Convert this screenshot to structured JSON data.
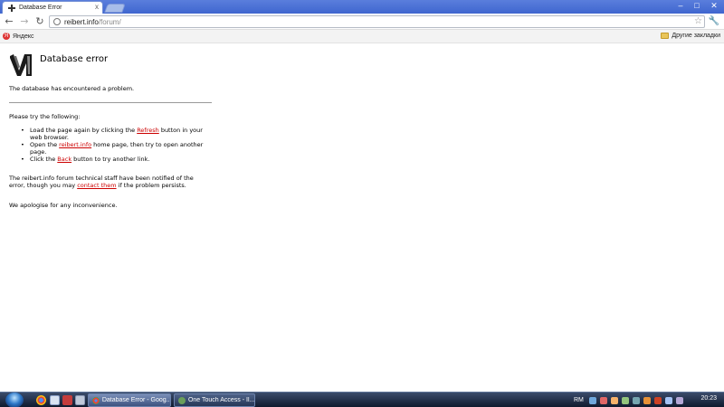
{
  "browser": {
    "tab_title": "Database Error",
    "tab_close": "x",
    "window_controls": {
      "minimize": "–",
      "maximize": "□",
      "close": "✕"
    },
    "url_host": "reibert.info",
    "url_path": "/forum/",
    "bookmark_yandex": "Яндекс",
    "bookmark_yandex_icon_letter": "Я",
    "bookmark_other": "Другие закладки"
  },
  "page": {
    "title": "Database error",
    "encountered": "The database has encountered a problem.",
    "please_try": "Please try the following:",
    "items": [
      {
        "pre": "Load the page again by clicking the ",
        "link": "Refresh",
        "post": " button in your web browser."
      },
      {
        "pre": "Open the ",
        "link": "reibert.info",
        "post": " home page, then try to open another page."
      },
      {
        "pre": "Click the ",
        "link": "Back",
        "post": " button to try another link."
      }
    ],
    "notified_pre": "The reibert.info forum technical staff have been notified of the error, though you may ",
    "notified_link": "contact them",
    "notified_post": " if the problem persists.",
    "apologise": "We apologise for any inconvenience."
  },
  "taskbar": {
    "task_db_label": "Database Error - Goog...",
    "task_ota_label": "One Touch Access - Il...",
    "lang": "RM",
    "clock": "20:23"
  },
  "colors": {
    "link": "#cc0000",
    "titlebar": "#3f66cf",
    "taskbar": "#0f1a2e"
  }
}
